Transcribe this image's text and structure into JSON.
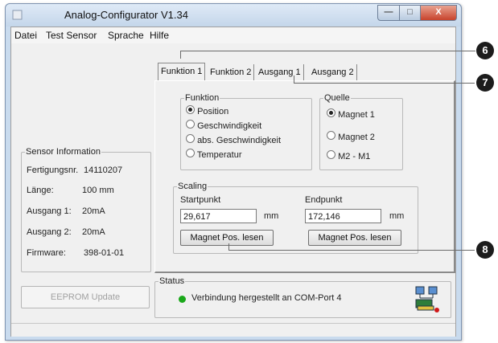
{
  "window": {
    "title": "Analog-Configurator V1.34",
    "min_glyph": "—",
    "max_glyph": "□",
    "close_glyph": "X"
  },
  "menu": {
    "items": [
      "Datei",
      "Test Sensor",
      "Sprache",
      "Hilfe"
    ]
  },
  "tabs": [
    {
      "label": "Funktion 1",
      "active": true
    },
    {
      "label": "Funktion 2",
      "active": false
    },
    {
      "label": "Ausgang 1",
      "active": false
    },
    {
      "label": "Ausgang 2",
      "active": false
    }
  ],
  "funktion": {
    "label": "Funktion",
    "options": [
      {
        "label": "Position",
        "checked": true
      },
      {
        "label": "Geschwindigkeit",
        "checked": false
      },
      {
        "label": "abs. Geschwindigkeit",
        "checked": false
      },
      {
        "label": "Temperatur",
        "checked": false
      }
    ]
  },
  "quelle": {
    "label": "Quelle",
    "options": [
      {
        "label": "Magnet 1",
        "checked": true
      },
      {
        "label": "Magnet 2",
        "checked": false
      },
      {
        "label": "M2 - M1",
        "checked": false
      }
    ]
  },
  "scaling": {
    "label": "Scaling",
    "start_label": "Startpunkt",
    "start_value": "29,617",
    "end_label": "Endpunkt",
    "end_value": "172,146",
    "unit": "mm",
    "read_button": "Magnet Pos. lesen"
  },
  "sensor_info": {
    "label": "Sensor Information",
    "rows": [
      {
        "key": "Fertigungsnr.",
        "value": "14110207"
      },
      {
        "key": "Länge:",
        "value": "100 mm"
      },
      {
        "key": "Ausgang 1:",
        "value": "20mA"
      },
      {
        "key": "Ausgang 2:",
        "value": "20mA"
      },
      {
        "key": "Firmware:",
        "value": "398-01-01"
      }
    ]
  },
  "eeprom_button": "EEPROM Update",
  "status": {
    "label": "Status",
    "message": "Verbindung hergestellt an COM-Port 4",
    "dot_color": "#1aa81a"
  },
  "callouts": [
    "6",
    "7",
    "8"
  ],
  "colors": {
    "window_frame": "#c9dbee",
    "close": "#c8432c",
    "callout": "#1c1c1c"
  }
}
